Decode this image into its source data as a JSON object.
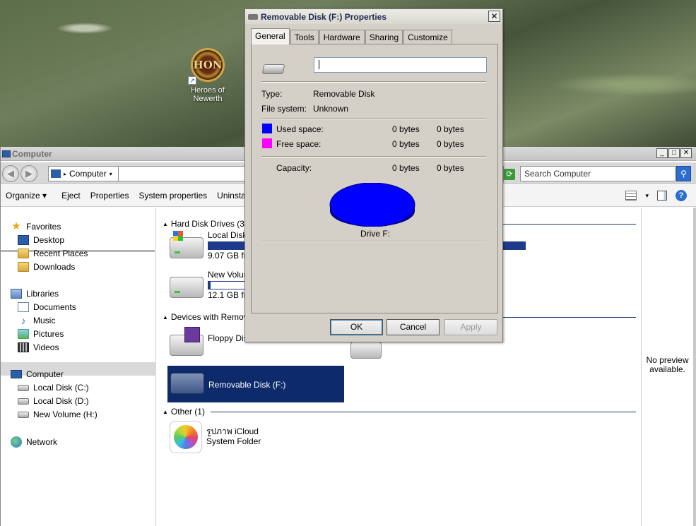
{
  "desktop": {
    "icon_logo": "HON",
    "icon_label_line1": "Heroes of",
    "icon_label_line2": "Newerth"
  },
  "explorer": {
    "title": "Computer",
    "address": "Computer",
    "search_placeholder": "Search Computer",
    "toolbar": [
      "Organize",
      "Eject",
      "Properties",
      "System properties",
      "Uninstall o"
    ],
    "nav": {
      "favorites": "Favorites",
      "desktop": "Desktop",
      "recent": "Recent Places",
      "downloads": "Downloads",
      "libraries": "Libraries",
      "documents": "Documents",
      "music": "Music",
      "pictures": "Pictures",
      "videos": "Videos",
      "computer": "Computer",
      "local_c": "Local Disk (C:)",
      "local_d": "Local Disk (D:)",
      "new_h": "New Volume (H:)",
      "network": "Network"
    },
    "groups": {
      "hdd": "Hard Disk Drives (3)",
      "removable": "Devices with Removab",
      "other": "Other (1)"
    },
    "drives": [
      {
        "name": "Local Disk (",
        "free": "9.07 GB fre",
        "used_fraction": 1.0
      },
      {
        "name": "New Volume",
        "free": "12.1 GB fre",
        "used_fraction": 0.05
      }
    ],
    "floppy": "Floppy Disk",
    "removable_f": "Removable Disk (F:)",
    "icloud_name": "รูปภาพ iCloud",
    "icloud_type": "System Folder",
    "preview": "No preview available."
  },
  "dialog": {
    "title": "Removable Disk (F:) Properties",
    "tabs": [
      "General",
      "Tools",
      "Hardware",
      "Sharing",
      "Customize"
    ],
    "label_value": "",
    "type_label": "Type:",
    "type_value": "Removable Disk",
    "fs_label": "File system:",
    "fs_value": "Unknown",
    "used_label": "Used space:",
    "used_bytes": "0 bytes",
    "used_bytes2": "0 bytes",
    "free_label": "Free space:",
    "free_bytes": "0 bytes",
    "free_bytes2": "0 bytes",
    "cap_label": "Capacity:",
    "cap_bytes": "0 bytes",
    "cap_bytes2": "0 bytes",
    "drive_label": "Drive F:",
    "ok": "OK",
    "cancel": "Cancel",
    "apply": "Apply",
    "used_color": "#0000ff",
    "free_color": "#ff00ff"
  }
}
